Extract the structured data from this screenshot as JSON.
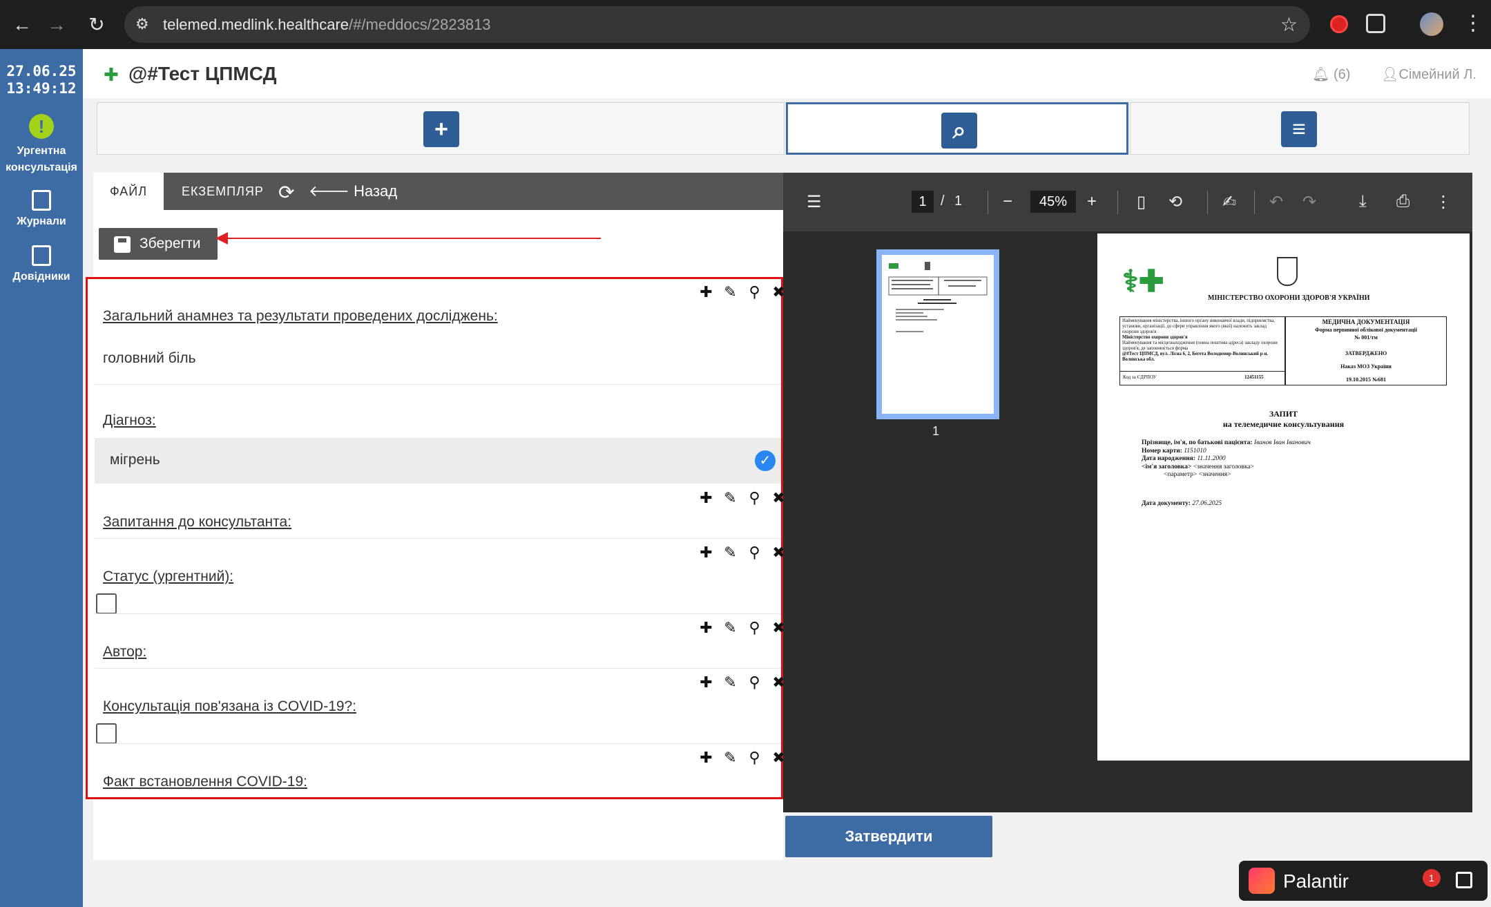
{
  "browser": {
    "url_host": "telemed.medlink.healthcare",
    "url_path": "/#/meddocs/2823813"
  },
  "sidebar": {
    "date": "27.06.25",
    "time": "13:49:12",
    "items": [
      {
        "label": "Ургентна консультація",
        "icon": "exclamation-icon"
      },
      {
        "label": "Журнали",
        "icon": "journal-icon"
      },
      {
        "label": "Довідники",
        "icon": "reference-book-icon"
      }
    ]
  },
  "header": {
    "title": "@#Тест ЦПМСД",
    "notifications": "(6)",
    "user": "Сімейний Л."
  },
  "editor": {
    "tab_file": "ФАЙЛ",
    "tab_instance": "ЕКЗЕМПЛЯР",
    "back_label": "Назад",
    "save_label": "Зберегти",
    "fields": [
      {
        "label": "Загальний анамнез та результати проведених досліджень:",
        "value": "головний біль"
      },
      {
        "label": "Діагноз:",
        "value": "мігрень"
      },
      {
        "label": "Запитання до консультанта:",
        "value": ""
      },
      {
        "label": "Статус (ургентний):",
        "checked": false
      },
      {
        "label": "Автор:",
        "value": ""
      },
      {
        "label": "Консультація пов'язана із COVID-19?:",
        "checked": false
      },
      {
        "label": "Факт встановлення COVID-19:",
        "value": ""
      }
    ]
  },
  "pdf": {
    "page_current": "1",
    "page_sep": "/",
    "page_total": "1",
    "zoom": "45%",
    "thumb_label": "1",
    "doc": {
      "ministry": "МІНІСТЕРСТВО ОХОРОНИ ЗДОРОВ'Я УКРАЇНИ",
      "left_block": "Найменування міністерства, іншого органу виконавчої влади, підприємства, установи, організації, до сфери управління якого (якої) належить заклад охорони здоров'я",
      "left_ministry": "Міністерство охорони здоров'я",
      "left_block2": "Найменування та місцезнаходження (повна поштова адреса) закладу охорони здоров'я, де заповнюється форма",
      "left_address": "@#Тест ЦПМСД, вул. Лісна 6, 2, Бегета Володимир-Волинський р-н. Волинська обл.",
      "edrpou_label": "Код за ЄДРПОУ",
      "edrpou": "12451155",
      "right_title": "МЕДИЧНА ДОКУМЕНТАЦІЯ",
      "right_form": "Форма первинної облікової документації",
      "right_num": "№ 001/тм",
      "approved": "ЗАТВЕРДЖЕНО",
      "order": "Наказ МОЗ України",
      "order_date": "19.10.2015 №681",
      "heading1": "ЗАПИТ",
      "heading2": "на телемедичне консультування",
      "patient_label": "Прізвище, ім'я, по батькові пацієнта:",
      "patient": "Іванов Іван Іванович",
      "card_label": "Номер карти:",
      "card": "1151010",
      "dob_label": "Дата народження:",
      "dob": "11.11.2000",
      "header_name": "<ім'я заголовка>",
      "header_value": "<значення заголовка>",
      "param_line": "<параметр> <значення>",
      "docdate_label": "Дата документу:",
      "docdate": "27.06.2025"
    },
    "approve_label": "Затвердити"
  },
  "palantir": {
    "name": "Palantir",
    "badge": "1"
  },
  "colors": {
    "sidebar": "#3d6ba3",
    "accent_red": "#d11111",
    "primary_button": "#3d6ba3"
  }
}
